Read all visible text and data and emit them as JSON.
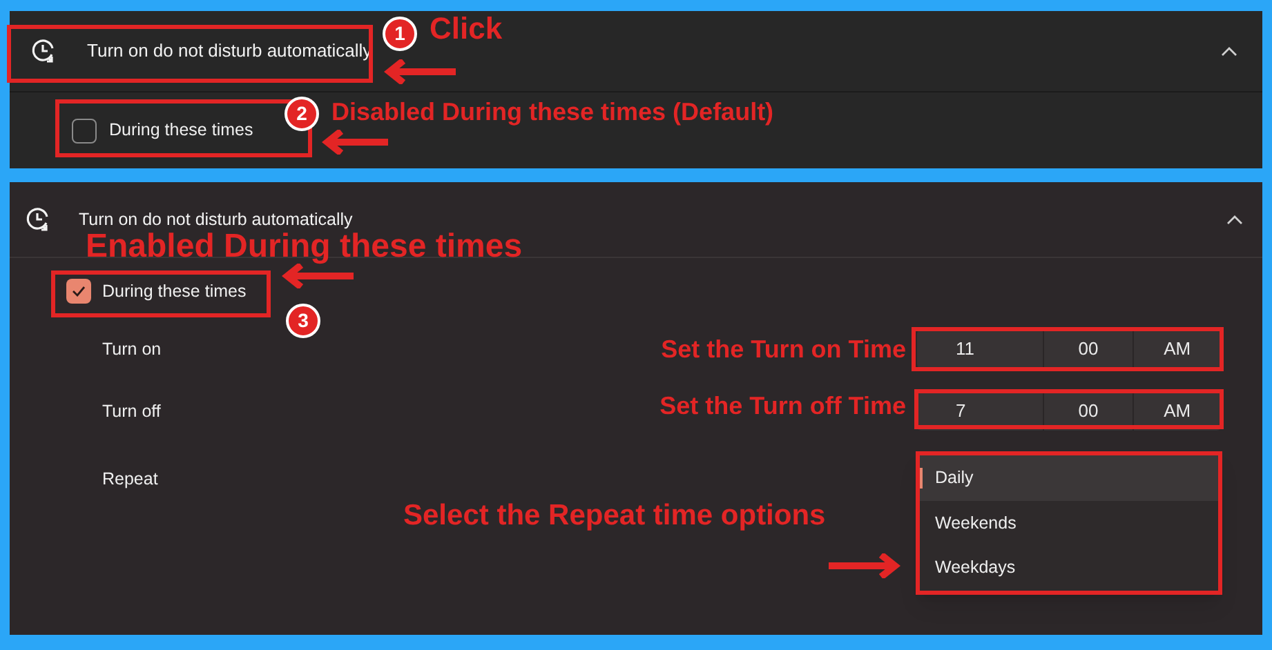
{
  "panels": [
    {
      "header": {
        "title": "Turn on do not disturb automatically",
        "expanded": true
      },
      "option": {
        "label": "During these times",
        "checked": false
      }
    },
    {
      "header": {
        "title": "Turn on do not disturb automatically",
        "expanded": true
      },
      "option": {
        "label": "During these times",
        "checked": true
      },
      "times": [
        {
          "label": "Turn on",
          "hour": "11",
          "minute": "00",
          "period": "AM"
        },
        {
          "label": "Turn off",
          "hour": "7",
          "minute": "00",
          "period": "AM"
        }
      ],
      "repeat": {
        "label": "Repeat",
        "options": [
          {
            "label": "Daily",
            "selected": true
          },
          {
            "label": "Weekends",
            "selected": false
          },
          {
            "label": "Weekdays",
            "selected": false
          }
        ]
      }
    }
  ],
  "annotations": [
    {
      "kind": "badge",
      "number": "1"
    },
    {
      "kind": "note",
      "text": "Click"
    },
    {
      "kind": "badge",
      "number": "2"
    },
    {
      "kind": "note",
      "text": "Disabled During these times (Default)"
    },
    {
      "kind": "note",
      "text": "Enabled During these times"
    },
    {
      "kind": "badge",
      "number": "3"
    },
    {
      "kind": "note",
      "text": "Set the Turn on Time"
    },
    {
      "kind": "note",
      "text": "Set the Turn off Time"
    },
    {
      "kind": "note",
      "text": "Select the Repeat time options"
    }
  ]
}
